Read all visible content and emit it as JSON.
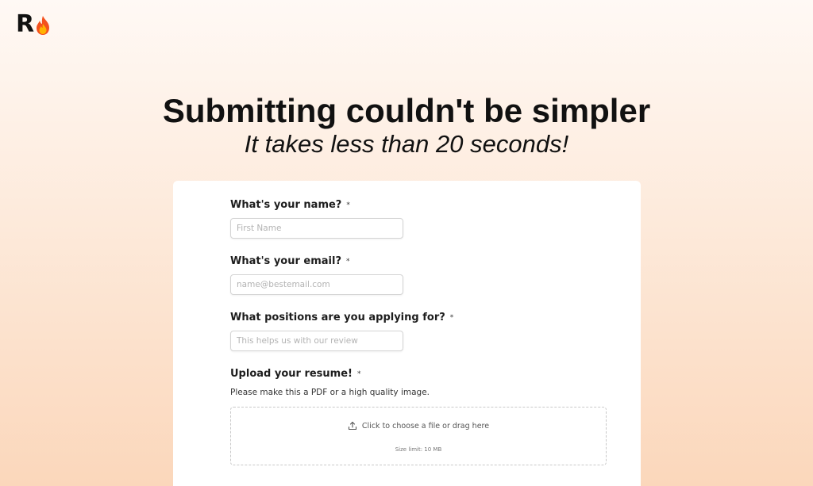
{
  "brand": {
    "letter": "R",
    "flame_icon": "fire-emoji-icon"
  },
  "hero": {
    "title": "Submitting couldn't be simpler",
    "subtitle": "It takes less than 20 seconds!"
  },
  "form": {
    "required_marker": "*",
    "name": {
      "label": "What's your name?",
      "placeholder": "First Name",
      "value": ""
    },
    "email": {
      "label": "What's your email?",
      "placeholder": "name@bestemail.com",
      "value": ""
    },
    "positions": {
      "label": "What positions are you applying for?",
      "placeholder": "This helps us with our review",
      "value": ""
    },
    "resume": {
      "label": "Upload your resume!",
      "helper": "Please make this a PDF or a high quality image.",
      "dropzone_text": "Click to choose a file or drag here",
      "dropzone_icon": "upload-icon",
      "size_limit": "Size limit: 10 MB"
    }
  },
  "colors": {
    "background_top": "#fff9f5",
    "background_bottom": "#fbd7bb",
    "card": "#ffffff",
    "text": "#111111"
  }
}
